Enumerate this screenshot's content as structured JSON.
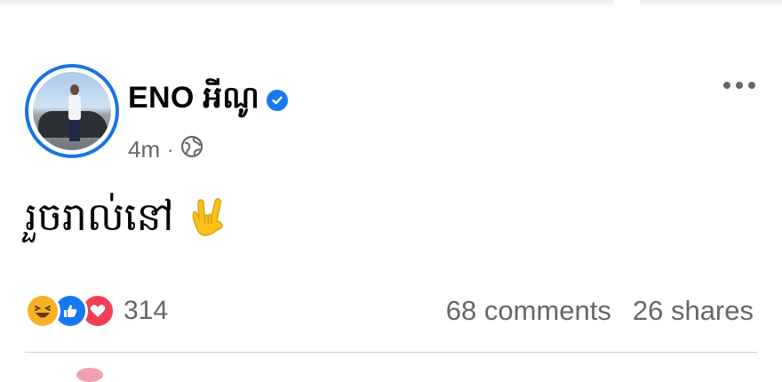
{
  "post": {
    "author": "ENO អីណូ",
    "time": "4m",
    "separator": "·",
    "privacy_icon": "globe-icon",
    "verified_icon": "verified-badge-icon",
    "more_icon": "more-options-icon",
    "text": "រួចរាល់នៅ",
    "emoji": "🤟",
    "reactions": {
      "types": [
        "haha",
        "like",
        "love"
      ],
      "count": "314"
    },
    "comments": "68 comments",
    "shares": "26 shares"
  },
  "colors": {
    "accent": "#1877f2",
    "secondary_text": "#65676b",
    "love": "#f33e58",
    "haha": "#f7b125"
  }
}
